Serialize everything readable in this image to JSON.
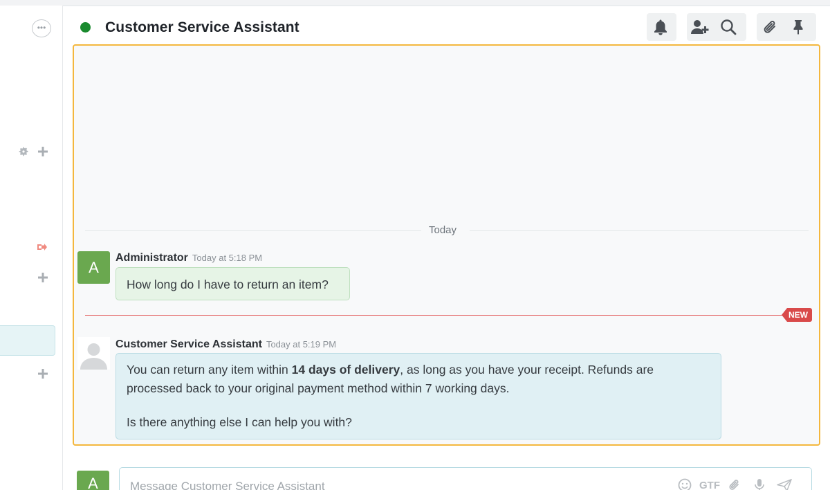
{
  "header": {
    "title": "Customer Service Assistant",
    "status_color": "#1a8a2e"
  },
  "sidebar": {
    "more_label": "•••"
  },
  "chat": {
    "day_separator": "Today",
    "new_badge": "NEW",
    "messages": [
      {
        "author": "Administrator",
        "avatar_letter": "A",
        "time": "Today at 5:18 PM",
        "text": "How long do I have to return an item?"
      },
      {
        "author": "Customer Service Assistant",
        "avatar": "default-user-avatar",
        "time": "Today at 5:19 PM",
        "text_before_bold": "You can return any item within ",
        "bold": "14 days of delivery",
        "text_after_bold": ", as long as you have your receipt. Refunds are processed back to your original payment method within 7 working days.",
        "text_line2": "Is there anything else I can help you with?"
      }
    ]
  },
  "composer": {
    "avatar_letter": "A",
    "placeholder": "Message Customer Service Assistant",
    "format_label": "GTF"
  },
  "colors": {
    "highlight_border": "#f4b73d",
    "user_bubble": "#e6f4e6",
    "bot_bubble": "#e0f0f4",
    "new_line": "#d94a4a",
    "avatar_green": "#6aa84f"
  }
}
